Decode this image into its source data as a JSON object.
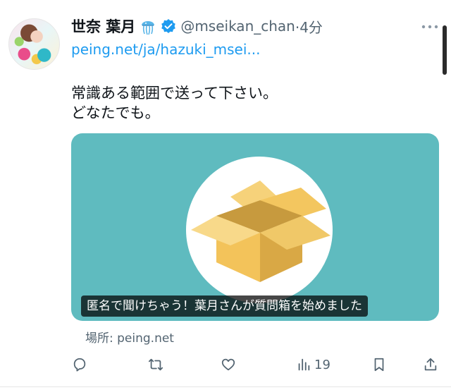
{
  "tweet": {
    "author_name": "世奈 葉月",
    "handle": "@mseikan_chan",
    "time": "·4分",
    "link": "peing.net/ja/hazuki_msei...",
    "text_lines": [
      "常識ある範囲で送って下さい。",
      "どなたでも。"
    ]
  },
  "card": {
    "caption": "匿名で聞けちゃう！葉月さんが質問箱を始めました",
    "source": "場所: peing.net",
    "background_color": "#5fbbbf"
  },
  "actions": {
    "views_count": "19"
  },
  "icons": {
    "jelly": "jellyfish-icon",
    "verified": "verified-badge-icon",
    "more": "more-options-icon",
    "reply": "reply-icon",
    "retweet": "retweet-icon",
    "like": "like-icon",
    "views": "views-icon",
    "bookmark": "bookmark-icon",
    "share": "share-icon"
  },
  "colors": {
    "link": "#1d9bf0",
    "verified": "#1d9bf0",
    "muted": "#536471"
  }
}
